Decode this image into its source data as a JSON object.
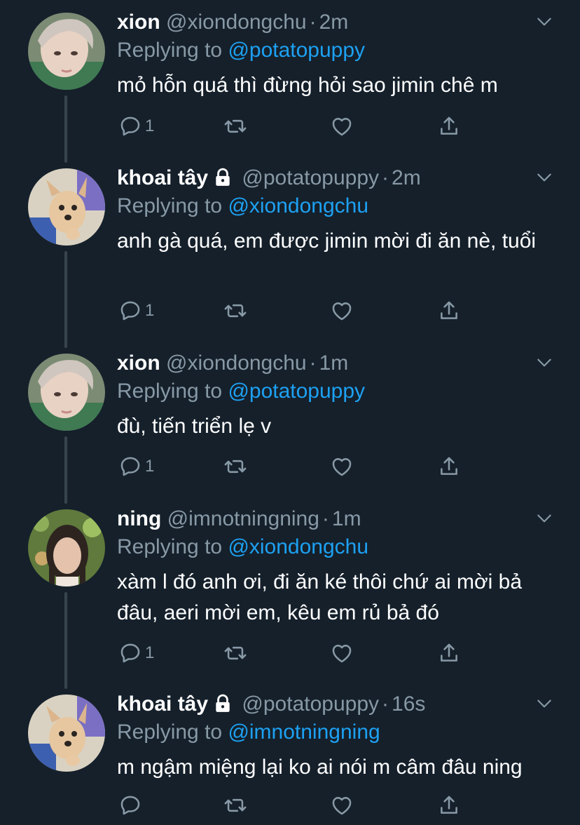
{
  "colors": {
    "background": "#15202b",
    "secondary_text": "#8899a6",
    "mention": "#1da1f2",
    "connector": "#38444d"
  },
  "icons": [
    "reply-icon",
    "retweet-icon",
    "like-icon",
    "share-icon",
    "lock-icon",
    "chevron-down-icon"
  ],
  "replying_prefix": "Replying to",
  "separator": "·",
  "tweets": [
    {
      "name": "xion",
      "handle": "@xiondongchu",
      "time": "2m",
      "replying_to": "@potatopuppy",
      "text": "mỏ hỗn quá thì đừng hỏi sao jimin chê m",
      "reply_count": "1",
      "protected": false
    },
    {
      "name": "khoai tây",
      "handle": "@potatopuppy",
      "time": "2m",
      "replying_to": "@xiondongchu",
      "text": "anh gà quá, em được jimin mời đi ăn nè, tuổi",
      "reply_count": "1",
      "protected": true
    },
    {
      "name": "xion",
      "handle": "@xiondongchu",
      "time": "1m",
      "replying_to": "@potatopuppy",
      "text": "đù, tiến triển lẹ v",
      "reply_count": "1",
      "protected": false
    },
    {
      "name": "ning",
      "handle": "@imnotningning",
      "time": "1m",
      "replying_to": "@xiondongchu",
      "text": "xàm l đó anh ơi, đi ăn ké thôi chứ ai mời bả đâu, aeri mời em, kêu em rủ bả đó",
      "reply_count": "1",
      "protected": false
    },
    {
      "name": "khoai tây",
      "handle": "@potatopuppy",
      "time": "16s",
      "replying_to": "@imnotningning",
      "text": "m ngậm miệng lại ko ai nói m câm đâu ning",
      "reply_count": "",
      "protected": true
    }
  ]
}
